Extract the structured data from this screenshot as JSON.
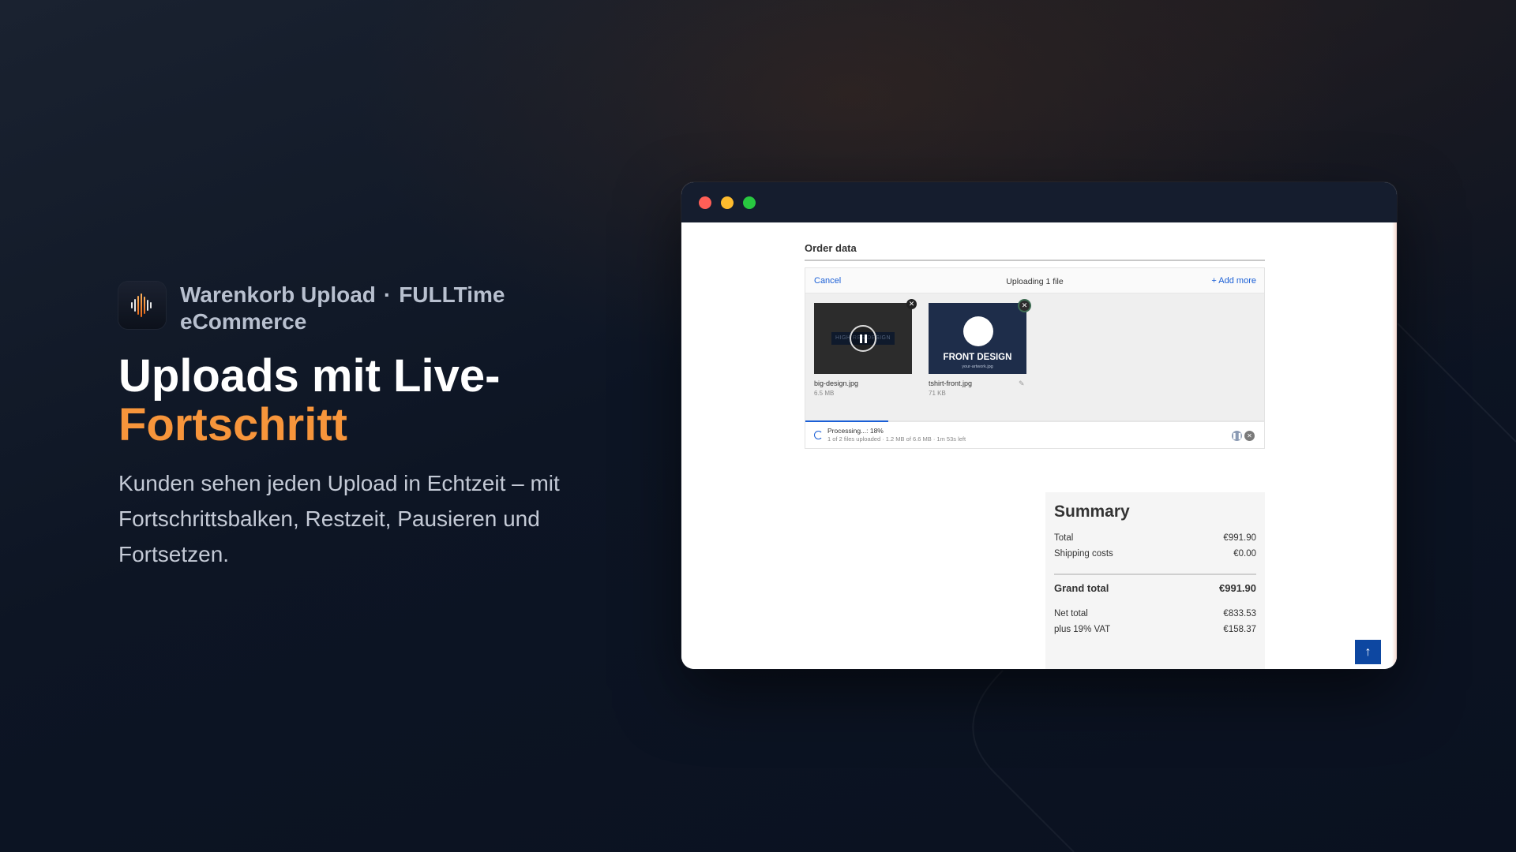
{
  "brand": {
    "app_name": "Warenkorb Upload",
    "separator": "·",
    "company": "FULLTime eCommerce"
  },
  "headline": {
    "line1": "Uploads mit Live-",
    "accent": "Fortschritt"
  },
  "description": "Kunden sehen jeden Upload in Echtzeit – mit Fortschrittsbalken, Restzeit, Pausieren und Fortsetzen.",
  "colors": {
    "accent": "#f7953b",
    "link": "#1a5fd6",
    "background": "#0b1220"
  },
  "window": {
    "order_title": "Order data",
    "uploader": {
      "cancel_label": "Cancel",
      "status": "Uploading 1 file",
      "add_more_label": "+ Add more",
      "files": [
        {
          "name": "big-design.jpg",
          "size": "6.5 MB",
          "thumb_text": "HIGH RES DESIGN",
          "state": "paused"
        },
        {
          "name": "tshirt-front.jpg",
          "size": "71 KB",
          "thumb_title": "FRONT DESIGN",
          "thumb_sub": "your-artwork.jpg",
          "state": "done"
        }
      ],
      "progress": {
        "label": "Processing...: 18%",
        "detail": "1 of 2 files uploaded · 1.2 MB of 6.6 MB · 1m 53s left",
        "percent": 18
      }
    },
    "summary": {
      "title": "Summary",
      "total_label": "Total",
      "total_value": "€991.90",
      "shipping_label": "Shipping costs",
      "shipping_value": "€0.00",
      "grand_label": "Grand total",
      "grand_value": "€991.90",
      "net_label": "Net total",
      "net_value": "€833.53",
      "vat_label": "plus 19% VAT",
      "vat_value": "€158.37"
    },
    "scroll_top_icon": "arrow-up-icon"
  }
}
